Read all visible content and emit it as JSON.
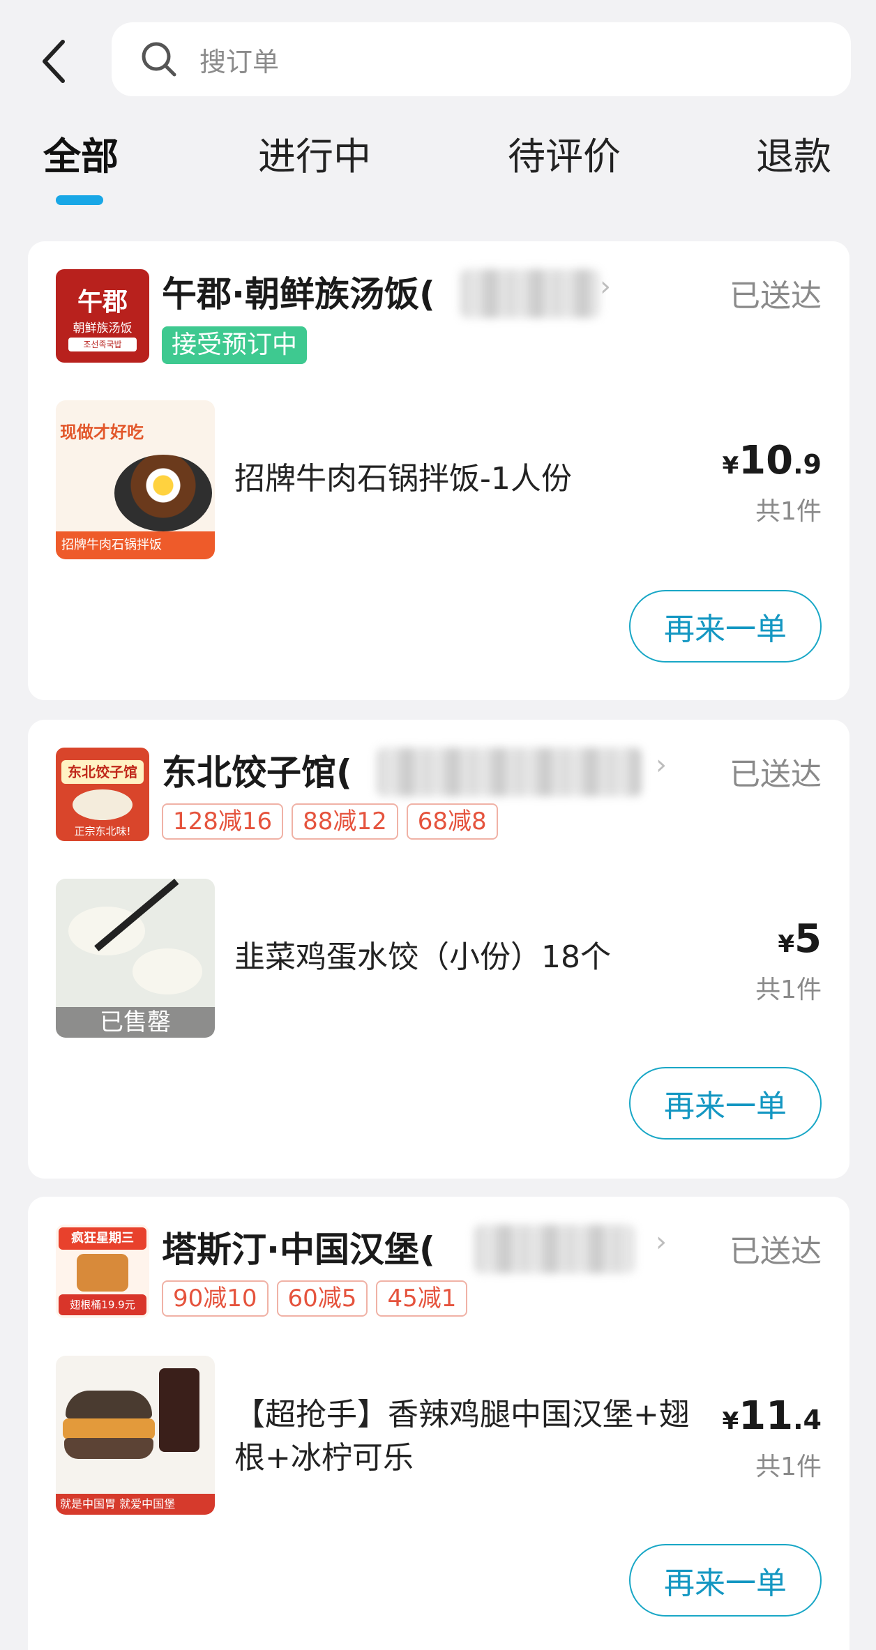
{
  "search": {
    "placeholder": "搜订单"
  },
  "tabs": [
    {
      "label": "全部",
      "active": true
    },
    {
      "label": "进行中",
      "active": false
    },
    {
      "label": "待评价",
      "active": false
    },
    {
      "label": "退款",
      "active": false
    }
  ],
  "colors": {
    "accent": "#19a7e6",
    "tag_green": "#3ec990",
    "promo_red": "#e5533d"
  },
  "orders": [
    {
      "store_name": "午郡·朝鲜族汤饭(",
      "status": "已送达",
      "tag": "接受预订中",
      "logo_text": {
        "main": "午郡",
        "sub": "朝鲜族汤饭",
        "kor": "조선족국밥"
      },
      "item_name": "招牌牛肉石锅拌饭-1人份",
      "price": {
        "currency": "¥",
        "integer": "10",
        "decimal": ".9"
      },
      "quantity": "共1件",
      "image_text": {
        "headline": "现做才好吃",
        "footer": "招牌牛肉石锅拌饭"
      },
      "reorder_label": "再来一单"
    },
    {
      "store_name": "东北饺子馆(",
      "status": "已送达",
      "promos": [
        "128减16",
        "88减12",
        "68减8"
      ],
      "logo_text": {
        "main": "东北饺子馆",
        "sub": "正宗东北味!"
      },
      "item_name": "韭菜鸡蛋水饺（小份）18个",
      "price": {
        "currency": "¥",
        "integer": "5",
        "decimal": ""
      },
      "quantity": "共1件",
      "sold_out": "已售罄",
      "reorder_label": "再来一单"
    },
    {
      "store_name": "塔斯汀·中国汉堡(",
      "status": "已送达",
      "promos": [
        "90减10",
        "60减5",
        "45减1"
      ],
      "logo_text": {
        "main": "疯狂星期三",
        "sub": "翅根桶19.9元"
      },
      "item_name": "【超抢手】香辣鸡腿中国汉堡+翅根+冰柠可乐",
      "price": {
        "currency": "¥",
        "integer": "11",
        "decimal": ".4"
      },
      "quantity": "共1件",
      "image_text": {
        "footer": "就是中国胃 就爱中国堡"
      },
      "reorder_label": "再来一单"
    }
  ]
}
